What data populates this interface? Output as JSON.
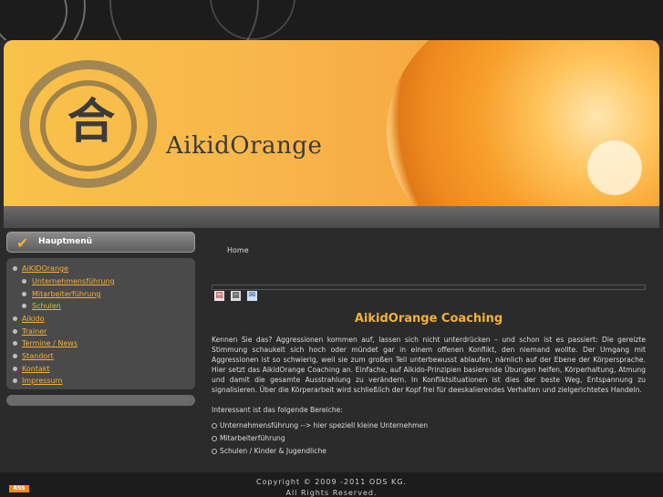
{
  "brand": {
    "name": "AikidOrange",
    "kanji": "合"
  },
  "menu": {
    "title": "Hauptmenü",
    "items": [
      {
        "label": "AiKIDOrange"
      },
      {
        "label": "Unternehmensführung"
      },
      {
        "label": "Mitarbeiterführung"
      },
      {
        "label": "Schulen"
      },
      {
        "label": "Aikido"
      },
      {
        "label": "Trainer"
      },
      {
        "label": "Termine / News"
      },
      {
        "label": "Standort"
      },
      {
        "label": "Kontakt"
      },
      {
        "label": "Impressum"
      }
    ]
  },
  "breadcrumb": "Home",
  "toolbar": {
    "pdf_icon": "pdf-icon",
    "print_icon": "print-icon",
    "email_icon": "email-icon"
  },
  "article": {
    "title": "AikidOrange Coaching",
    "body": "Kennen Sie das? Aggressionen kommen auf, lassen sich nicht unterdrücken – und schon ist es passiert: Die gereizte Stimmung schaukelt sich hoch oder mündet gar in einem offenen Konflikt, den niemand wollte. Der Umgang mit Aggressionen ist so schwierig, weil sie zum großen Teil unterbewusst ablaufen, nämlich auf der Ebene der Körpersprache. Hier setzt das AikidOrange Coaching an. Einfache, auf Aikido-Prinzipien basierende Übungen helfen, Körperhaltung, Atmung und damit die gesamte Ausstrahlung zu verändern. In Konfliktsituationen ist dies der beste Weg, Entspannung zu signalisieren. Über die Körperarbeit wird schließlich der Kopf frei für deeskalierendes Verhalten und zielgerichtetes Handeln.",
    "intro": "Interessant ist das folgende Bereiche:",
    "list": [
      "Unternehmensführung --> hier speziell kleine Unternehmen",
      "Mitarbeiterführung",
      "Schulen / Kinder & Jugendliche"
    ]
  },
  "footer": {
    "copyright": "Copyright © 2009 -2011 ODS KG.",
    "rights": "All Rights Reserved.",
    "rss": "RSS"
  },
  "colors": {
    "accent": "#f3b13a",
    "background": "#2b2b2b",
    "menu_bg": "#4a4a4a"
  }
}
